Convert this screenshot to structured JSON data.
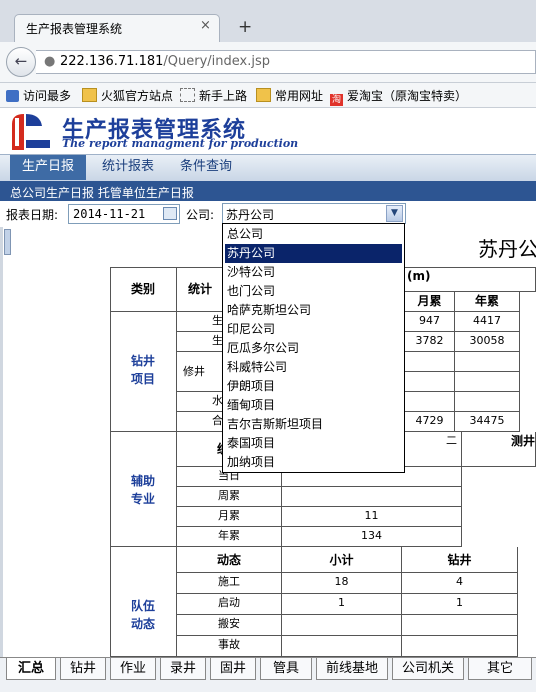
{
  "browser": {
    "tab_title": "生产报表管理系统",
    "tab_close": "×",
    "new_tab": "+",
    "url_host": "222.136.71.181",
    "url_path": "/Query/index.jsp",
    "bookmarks": [
      "访问最多",
      "火狐官方站点",
      "新手上路",
      "常用网址",
      "爱淘宝（原淘宝特卖）"
    ]
  },
  "app": {
    "title": "生产报表管理系统",
    "subtitle": "The report managment for production",
    "nav": [
      "生产日报",
      "统计报表",
      "条件查询"
    ],
    "subnav": "总公司生产日报  托管单位生产日报"
  },
  "filter": {
    "date_label": "报表日期:",
    "date_value": "2014-11-21",
    "company_label": "公司:",
    "company_value": "苏丹公司",
    "company_options": [
      "总公司",
      "苏丹公司",
      "沙特公司",
      "也门公司",
      "哈萨克斯坦公司",
      "印尼公司",
      "厄瓜多尔公司",
      "科威特公司",
      "伊朗项目",
      "缅甸项目",
      "吉尔吉斯斯坦项目",
      "泰国项目",
      "加纳项目"
    ],
    "selected_index": 1
  },
  "report": {
    "title": "苏丹公",
    "table": {
      "h_category": "类别",
      "h_stat": "统计",
      "h_unit": "(m)",
      "h_month": "月累",
      "h_year": "年累",
      "drill_group": "钻井\n项目",
      "repair": "修井",
      "frag_mid1": "生",
      "frag_mid2": "才",
      "frag_mid3": "水",
      "frag_total": "合",
      "rows_right": [
        [
          "947",
          "4417"
        ],
        [
          "3782",
          "30058"
        ],
        [
          "",
          ""
        ],
        [
          "",
          ""
        ],
        [
          "",
          ""
        ],
        [
          "",
          ""
        ],
        [
          "4729",
          "34475"
        ]
      ],
      "aux_group": "辅助\n专业",
      "aux_stat": "统计",
      "aux_frag": "二",
      "logging_frag": "测井",
      "logging_frag2": "(",
      "aux_rows": [
        [
          "当日",
          ""
        ],
        [
          "周累",
          ""
        ],
        [
          "月累",
          "11"
        ],
        [
          "年累",
          "134"
        ]
      ],
      "team_group": "队伍\n动态",
      "team_h_dyn": "动态",
      "team_h_sub": "小计",
      "team_h_drill": "钻井",
      "team_rows": [
        [
          "施工",
          "18",
          "4"
        ],
        [
          "启动",
          "1",
          "1"
        ],
        [
          "搬安",
          "",
          ""
        ],
        [
          "事故",
          "",
          ""
        ]
      ]
    }
  },
  "bottom_tabs": [
    "汇总",
    "钻井",
    "作业",
    "录井",
    "固井",
    "管具",
    "前线基地",
    "公司机关",
    "其它"
  ],
  "colors": {
    "brand": "#1d3f9a",
    "nav_active": "#3e6ba5",
    "subnav": "#2d5592",
    "selected": "#0a246a"
  }
}
